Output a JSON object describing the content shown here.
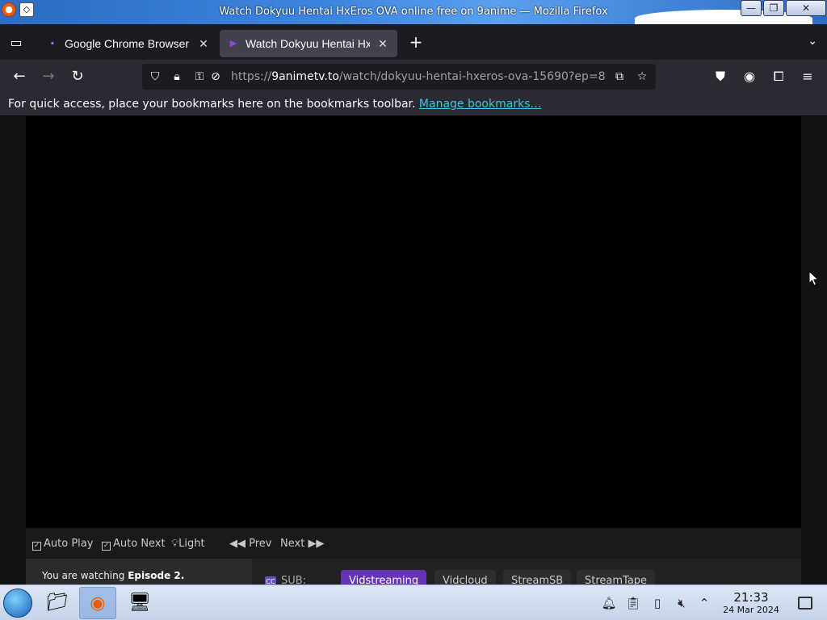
{
  "window": {
    "title": "Watch Dokyuu Hentai HxEros OVA online free on 9anime — Mozilla Firefox",
    "minimize": "—",
    "maximize": "❐",
    "close": "✕"
  },
  "tabs": [
    {
      "label": "Google Chrome Browser",
      "active": false
    },
    {
      "label": "Watch Dokyuu Hentai Hx",
      "active": true
    }
  ],
  "tab_close_glyph": "✕",
  "new_tab_glyph": "+",
  "address": {
    "url_prefix": "https://",
    "url_domain": "9animetv.to",
    "url_path": "/watch/dokyuu-hentai-hxeros-ova-15690?ep=8"
  },
  "bookmarks_bar": {
    "message": "For quick access, place your bookmarks here on the bookmarks toolbar.",
    "link": "Manage bookmarks…"
  },
  "player_controls": {
    "auto_play": "Auto Play",
    "auto_next": "Auto Next",
    "light": "Light",
    "prev": "Prev",
    "next": "Next"
  },
  "episode_info": {
    "prefix": "You are watching",
    "episode": "Episode 2."
  },
  "servers": {
    "label": "SUB:",
    "items": [
      "Vidstreaming",
      "Vidcloud",
      "StreamSB",
      "StreamTape"
    ],
    "active_index": 0
  },
  "taskbar": {
    "time": "21:33",
    "date": "24 Mar 2024"
  },
  "colors": {
    "accent_server": "#6633b8",
    "link": "#45c0e8",
    "tab_active": "#42414d"
  }
}
